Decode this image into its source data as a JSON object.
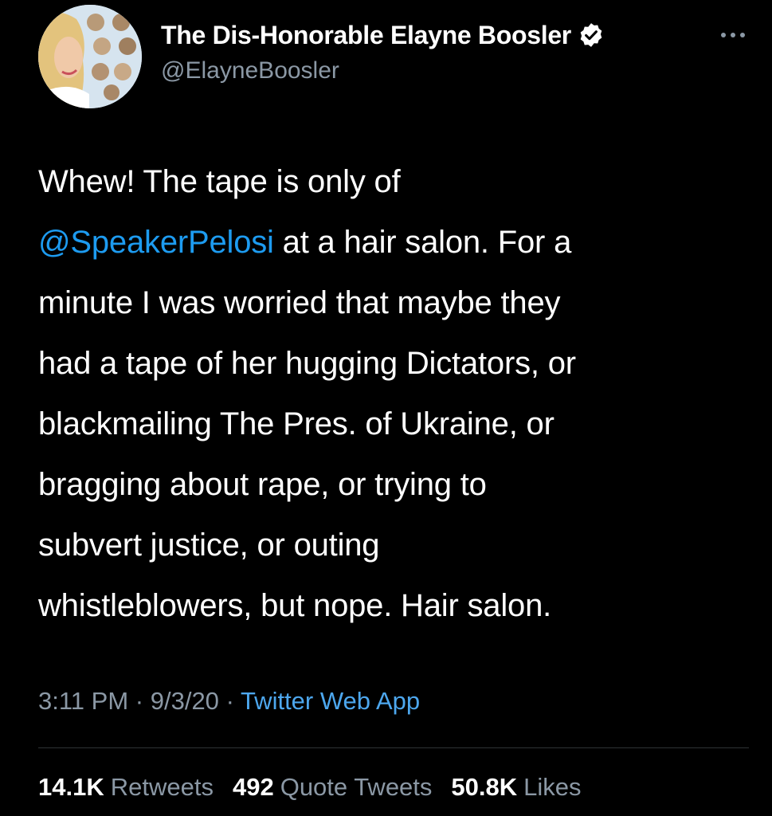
{
  "author": {
    "display_name": "The Dis-Honorable Elayne Boosler",
    "handle": "@ElayneBoosler",
    "verified": true,
    "avatar_icon": "profile-photo"
  },
  "tweet": {
    "lines": [
      {
        "text": "Whew! The tape is only of"
      },
      {
        "mention": "@SpeakerPelosi",
        "text": " at a hair salon. For a"
      },
      {
        "text": "minute I was worried that maybe they"
      },
      {
        "text": "had a tape of her hugging Dictators, or"
      },
      {
        "text": "blackmailing The Pres. of Ukraine, or"
      },
      {
        "text": "bragging about rape, or trying to"
      },
      {
        "text": "subvert justice, or outing"
      },
      {
        "text": "whistleblowers, but nope. Hair salon."
      }
    ]
  },
  "meta": {
    "time": "3:11 PM",
    "separator": "·",
    "date": "9/3/20",
    "source": "Twitter Web App"
  },
  "stats": [
    {
      "count": "14.1K",
      "label": "Retweets"
    },
    {
      "count": "492",
      "label": "Quote Tweets"
    },
    {
      "count": "50.8K",
      "label": "Likes"
    }
  ],
  "colors": {
    "background": "#000000",
    "link": "#1d9bf0",
    "secondary_text": "#8b98a5",
    "divider": "#2f3336"
  },
  "icons": {
    "verified": "verified-badge-icon",
    "more": "more-options-icon"
  }
}
